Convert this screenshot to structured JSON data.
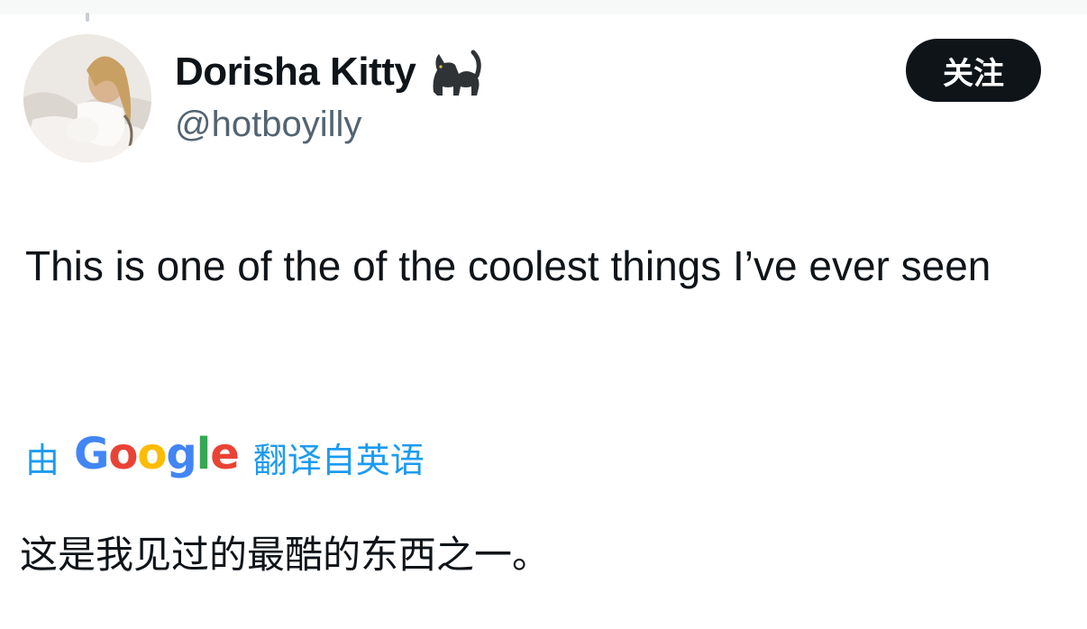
{
  "user": {
    "display_name": "Dorisha Kitty",
    "name_emoji": "black-cat-icon",
    "handle": "@hotboyilly"
  },
  "follow_button": {
    "label": "关注",
    "bg_color": "#0f1419",
    "text_color": "#ffffff"
  },
  "tweet": {
    "text": "This is one of the of the coolest things I’ve ever seen"
  },
  "translation": {
    "prefix": "由",
    "provider": "Google",
    "suffix": "翻译自英语",
    "text": "这是我见过的最酷的东西之一。",
    "link_color": "#1d9bf0"
  },
  "colors": {
    "text_primary": "#0f1419",
    "text_secondary": "#536471",
    "google_blue": "#4285f4",
    "google_red": "#ea4335",
    "google_yellow": "#fbbc05",
    "google_green": "#34a853"
  }
}
